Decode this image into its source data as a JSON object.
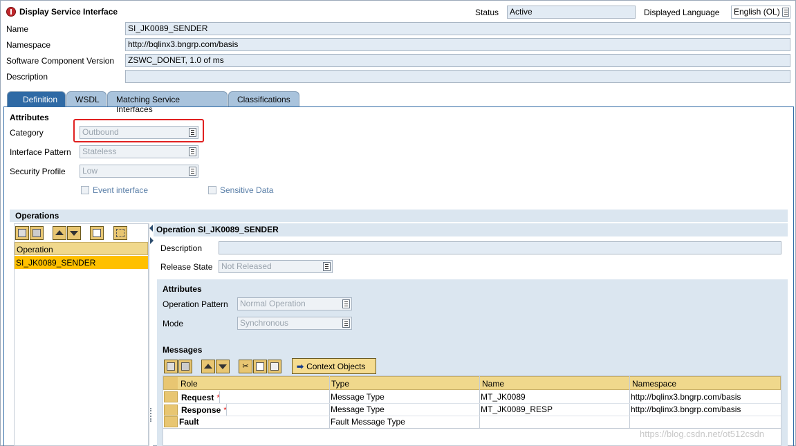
{
  "header": {
    "title": "Display Service Interface",
    "status_label": "Status",
    "status_value": "Active",
    "language_label": "Displayed Language",
    "language_value": "English (OL)"
  },
  "fields": {
    "name_label": "Name",
    "name_value": "SI_JK0089_SENDER",
    "namespace_label": "Namespace",
    "namespace_value": "http://bqlinx3.bngrp.com/basis",
    "scv_label": "Software Component Version",
    "scv_value": "ZSWC_DONET, 1.0 of ms",
    "description_label": "Description",
    "description_value": ""
  },
  "tabs": [
    {
      "label": "Definition"
    },
    {
      "label": "WSDL"
    },
    {
      "label": "Matching Service Interfaces"
    },
    {
      "label": "Classifications"
    }
  ],
  "attributes": {
    "title": "Attributes",
    "category_label": "Category",
    "category_value": "Outbound",
    "pattern_label": "Interface Pattern",
    "pattern_value": "Stateless",
    "security_label": "Security Profile",
    "security_value": "Low",
    "event_label": "Event interface",
    "sensitive_label": "Sensitive Data"
  },
  "operations": {
    "title": "Operations",
    "col_header": "Operation",
    "items": [
      "SI_JK0089_SENDER"
    ]
  },
  "operation_detail": {
    "title": "Operation SI_JK0089_SENDER",
    "description_label": "Description",
    "description_value": "",
    "release_label": "Release State",
    "release_value": "Not Released",
    "attr_title": "Attributes",
    "op_pattern_label": "Operation Pattern",
    "op_pattern_value": "Normal Operation",
    "mode_label": "Mode",
    "mode_value": "Synchronous"
  },
  "messages": {
    "title": "Messages",
    "context_button": "Context Objects",
    "columns": [
      "Role",
      "Type",
      "Name",
      "Namespace"
    ],
    "rows": [
      {
        "role": "Request",
        "required": "*",
        "type": "Message Type",
        "name": "MT_JK0089",
        "namespace": "http://bqlinx3.bngrp.com/basis"
      },
      {
        "role": "Response",
        "required": "*",
        "type": "Message Type",
        "name": "MT_JK0089_RESP",
        "namespace": "http://bqlinx3.bngrp.com/basis"
      },
      {
        "role": "Fault",
        "required": "",
        "type": "Fault Message Type",
        "name": "",
        "namespace": ""
      }
    ]
  },
  "watermark": "https://blog.csdn.net/ot512csdn",
  "colors": {
    "highlight_box": "#e02020",
    "selected_row": "#ffc000",
    "active_tab": "#2f6aa5"
  }
}
